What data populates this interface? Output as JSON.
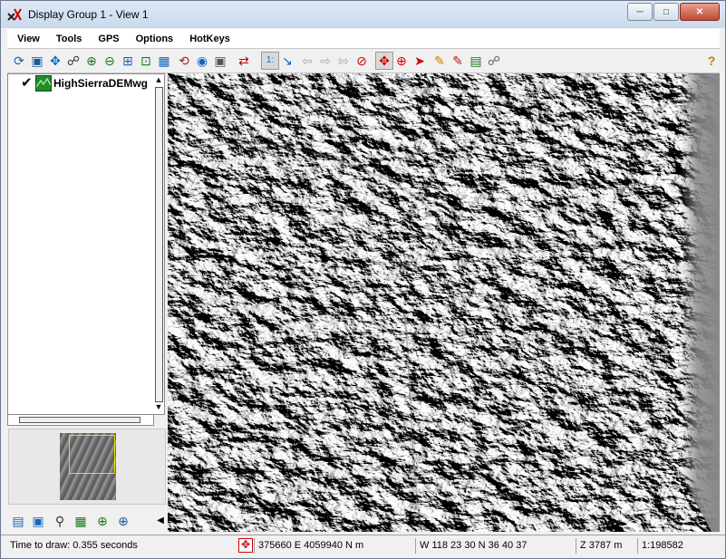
{
  "window": {
    "title": "Display Group 1 - View 1",
    "app_icon": "tntmips-app-icon",
    "controls": [
      "minimize-icon",
      "maximize-icon",
      "close-icon"
    ]
  },
  "menu": {
    "items": [
      {
        "label": "View"
      },
      {
        "label": "Tools"
      },
      {
        "label": "GPS"
      },
      {
        "label": "Options"
      },
      {
        "label": "HotKeys"
      }
    ]
  },
  "toolbar": {
    "buttons": [
      "redraw-icon",
      "full-view-icon",
      "zoom-to-layer-icon",
      "binoculars-icon",
      "zoom-in-icon",
      "zoom-out-icon",
      "zoom-box-icon",
      "fit-icon",
      "pan-lock-icon",
      "refresh-icon",
      "palette-icon",
      "snapshot-icon",
      "add-layer-icon",
      "scale-1to1-icon",
      "cursor-pointer-icon",
      "history-back-icon",
      "history-forward-icon",
      "cancel-draw-icon",
      "pan-tool-icon",
      "zoom-tool-icon",
      "select-arrow-icon",
      "sketch-tool-icon",
      "legend-tool-icon",
      "print-icon",
      "gps-icon",
      "help-icon"
    ]
  },
  "layers": [
    {
      "name": "HighSierraDEMwg",
      "visible": true,
      "icon": "raster-layer-icon"
    }
  ],
  "left_tools": [
    "legend-view-icon",
    "layer-manager-icon",
    "zoom-locator-icon",
    "overview-map-icon",
    "zoom-in-small-icon",
    "zoom-out-small-icon",
    "collapse-panel-icon"
  ],
  "status": {
    "time_to_draw": "Time to draw: 0.355 seconds",
    "map_coords": "375660 E  4059940 N m",
    "latlon": "W 118 23 30  N 36 40 37",
    "elevation": "Z 3787 m",
    "scale": "1:198582"
  },
  "colors": {
    "titlebar": "#c9d9ec",
    "close_button": "#c24a30",
    "layer_icon_green": "#1e8c2a",
    "overview_box": "#e8e000",
    "map_flat_gray": "#8a8a8a"
  }
}
